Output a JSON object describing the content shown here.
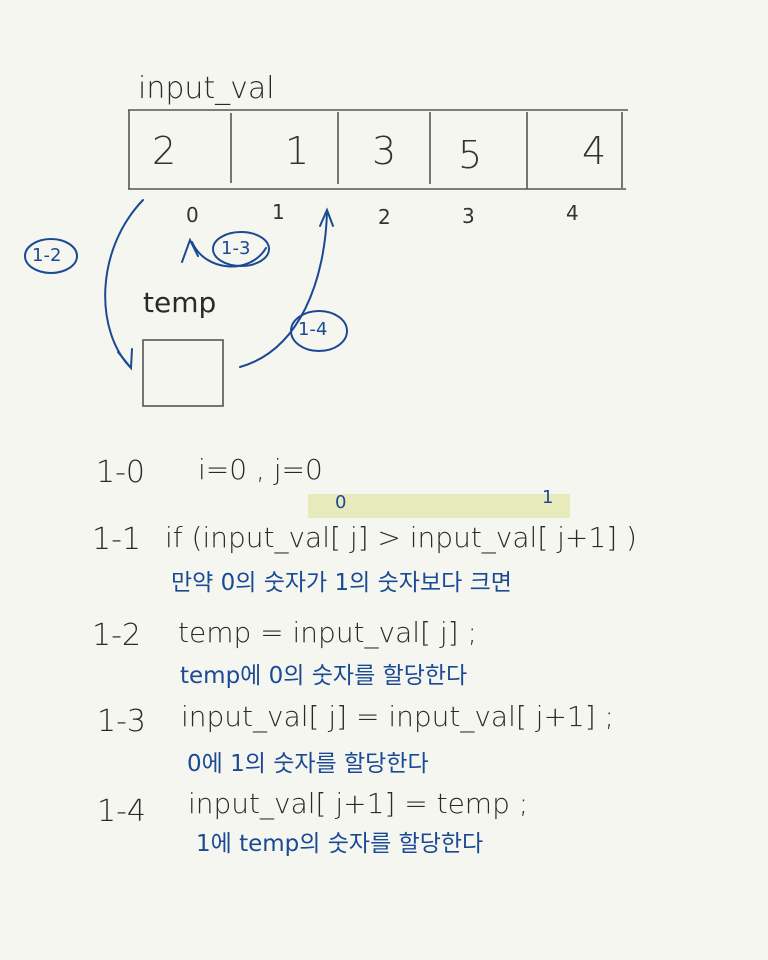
{
  "array": {
    "label": "input_val",
    "values": [
      "2",
      "1",
      "3",
      "5",
      "4"
    ],
    "indices": [
      "0",
      "1",
      "2",
      "3",
      "4"
    ]
  },
  "temp": {
    "label": "temp"
  },
  "arrows": [
    "1-2",
    "1-3",
    "1-4"
  ],
  "highlight": {
    "left_index": "0",
    "right_index": "1"
  },
  "steps": [
    {
      "id": "1-0",
      "code": "i=0 , j=0",
      "note": ""
    },
    {
      "id": "1-1",
      "code": "if (input_val[ j] > input_val[ j+1] )",
      "note": "만약 0의 숫자가 1의 숫자보다 크면"
    },
    {
      "id": "1-2",
      "code": "temp = input_val[ j] ;",
      "note": "temp에 0의 숫자를 할당한다"
    },
    {
      "id": "1-3",
      "code": "input_val[ j] = input_val[ j+1] ;",
      "note": "0에 1의 숫자를 할당한다"
    },
    {
      "id": "1-4",
      "code": "input_val[ j+1] = temp ;",
      "note": "1에 temp의 숫자를 할당한다"
    }
  ],
  "colors": {
    "ink": "#2a2a2a",
    "blue": "#1b4a94",
    "highlight": "#e6e9b4",
    "background": "#f6f6f1"
  }
}
